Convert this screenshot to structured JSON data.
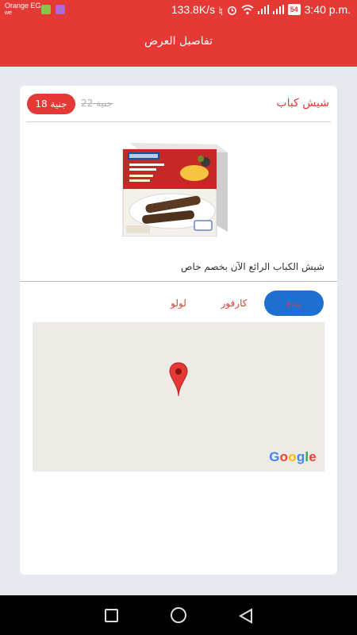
{
  "status_bar": {
    "carrier": "Orange EG",
    "carrier_sub": "we",
    "speed": "133.8K/s",
    "battery": "54",
    "time": "3:40 p.m."
  },
  "app_bar": {
    "title": "تفاصيل العرض"
  },
  "offer": {
    "title": "شيش كباب",
    "new_price": "18 جنية",
    "old_price": "22 جنية",
    "description": "شيش الكباب الرائع الآن بخصم خاص"
  },
  "stores": {
    "tabs": [
      {
        "label": "بندة",
        "active": true
      },
      {
        "label": "كارفور",
        "active": false
      },
      {
        "label": "لولو",
        "active": false
      }
    ]
  },
  "map": {
    "provider_logo": "Google"
  },
  "colors": {
    "primary": "#e53935",
    "active_tab": "#1e6fd0",
    "background": "#e6e9ee"
  }
}
